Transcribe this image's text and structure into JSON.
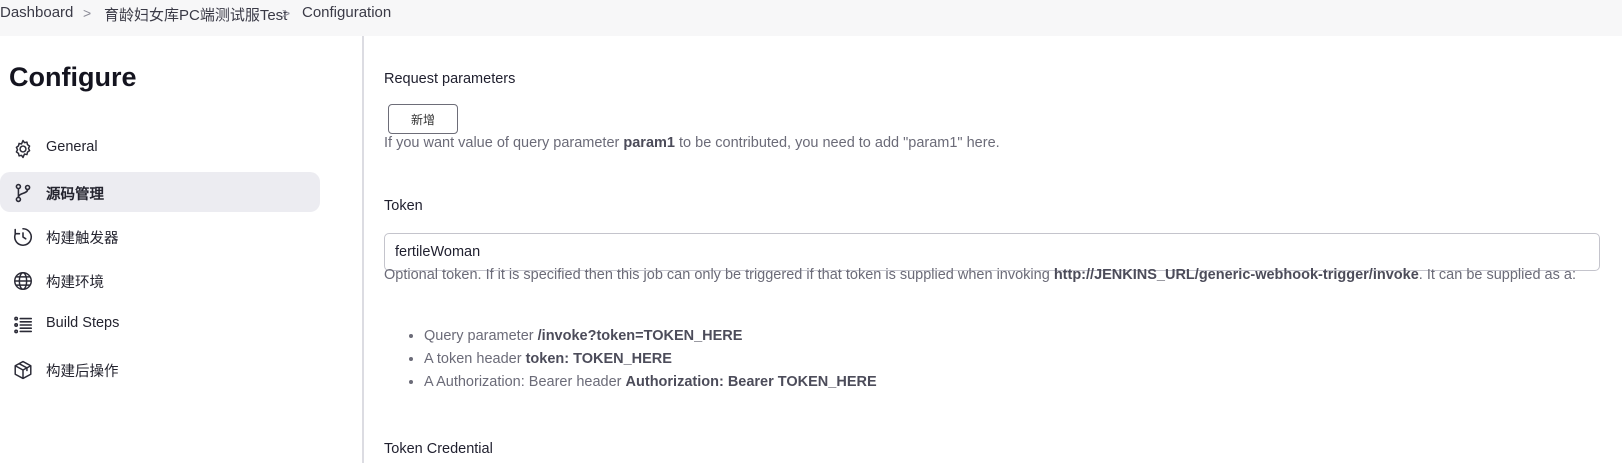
{
  "breadcrumb": {
    "items": [
      "Dashboard",
      "育龄妇女库PC端测试服Test",
      "Configuration"
    ],
    "separator": ">"
  },
  "sidebar": {
    "title": "Configure",
    "items": [
      {
        "label": "General",
        "icon": "gear-icon"
      },
      {
        "label": "源码管理",
        "icon": "branch-icon",
        "active": true
      },
      {
        "label": "构建触发器",
        "icon": "clock-icon"
      },
      {
        "label": "构建环境",
        "icon": "globe-icon"
      },
      {
        "label": "Build Steps",
        "icon": "list-icon"
      },
      {
        "label": "构建后操作",
        "icon": "package-icon"
      }
    ]
  },
  "main": {
    "request_parameters": {
      "label": "Request parameters",
      "add_button": "新增",
      "help_prefix": "If you want value of query parameter ",
      "help_param": "param1",
      "help_suffix": " to be contributed, you need to add \"param1\" here."
    },
    "token": {
      "label": "Token",
      "value": "fertileWoman",
      "help_prefix": "Optional token. If it is specified then this job can only be triggered if that token is supplied when invoking ",
      "help_url": "http://JENKINS_URL/generic-webhook-trigger/invoke",
      "help_suffix": ". It can be supplied as a:",
      "bullets": [
        {
          "text": "Query parameter ",
          "bold": "/invoke?token",
          "tail": "=TOKEN_HERE"
        },
        {
          "text": "A token header ",
          "bold": "token: TOKEN_HERE",
          "tail": ""
        },
        {
          "text": "A Authorization: Bearer header ",
          "bold": "Authorization: Bearer TOKEN_HERE",
          "tail": ""
        }
      ]
    },
    "token_credential": {
      "label": "Token Credential"
    }
  },
  "colors": {
    "active_nav_bg": "#ececf1",
    "help_text": "#6b6b78",
    "breadcrumb_bg": "#f7f7f8"
  }
}
